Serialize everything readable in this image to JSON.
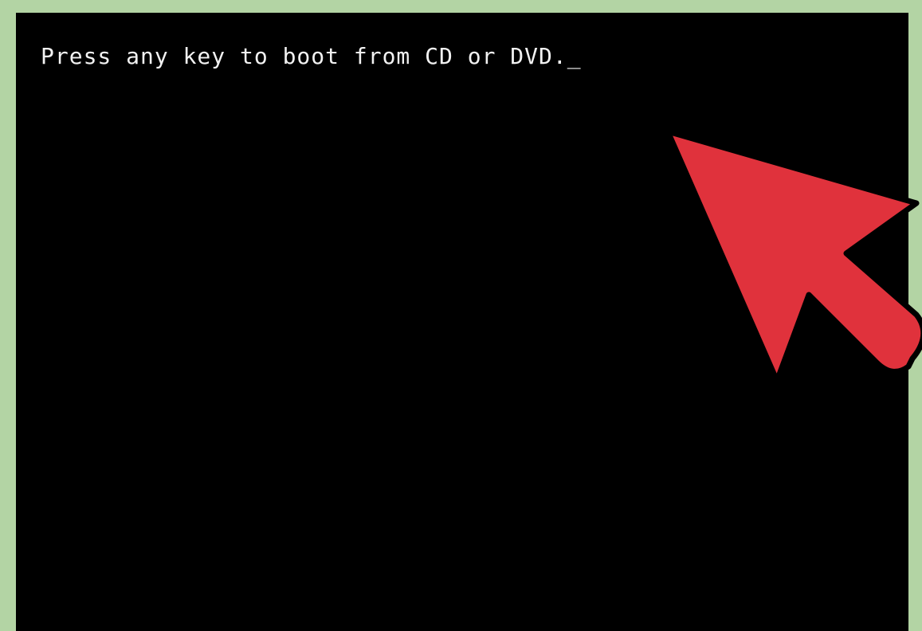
{
  "screen": {
    "message": "Press any key to boot from CD or DVD.",
    "cursor": "_",
    "background_color": "#000000",
    "text_color": "#f2f2f2"
  },
  "frame": {
    "border_color": "#b3d4a4"
  },
  "pointer": {
    "icon": "arrow-pointer-icon",
    "color": "#e0323c",
    "outline_color": "#000000"
  }
}
